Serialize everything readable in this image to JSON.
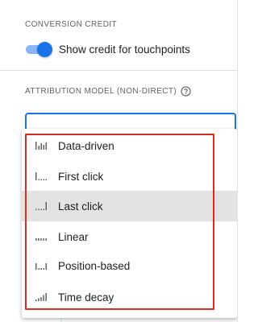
{
  "conversion_credit": {
    "heading": "CONVERSION CREDIT",
    "toggle_label": "Show credit for touchpoints",
    "toggle_on": true
  },
  "attribution": {
    "heading": "ATTRIBUTION MODEL (NON-DIRECT)",
    "help_icon": "help-circle-icon"
  },
  "dropdown": {
    "options": [
      {
        "label": "Data-driven",
        "icon": "bars-data-driven-icon"
      },
      {
        "label": "First click",
        "icon": "bars-first-click-icon"
      },
      {
        "label": "Last click",
        "icon": "bars-last-click-icon",
        "selected": true
      },
      {
        "label": "Linear",
        "icon": "bars-linear-icon"
      },
      {
        "label": "Position-based",
        "icon": "bars-position-based-icon"
      },
      {
        "label": "Time decay",
        "icon": "bars-time-decay-icon"
      }
    ]
  },
  "colors": {
    "accent": "#1a73e8",
    "accent_light": "#8ab4f8",
    "highlight_border": "#d92d20",
    "selected_bg": "#e3e3e3"
  }
}
